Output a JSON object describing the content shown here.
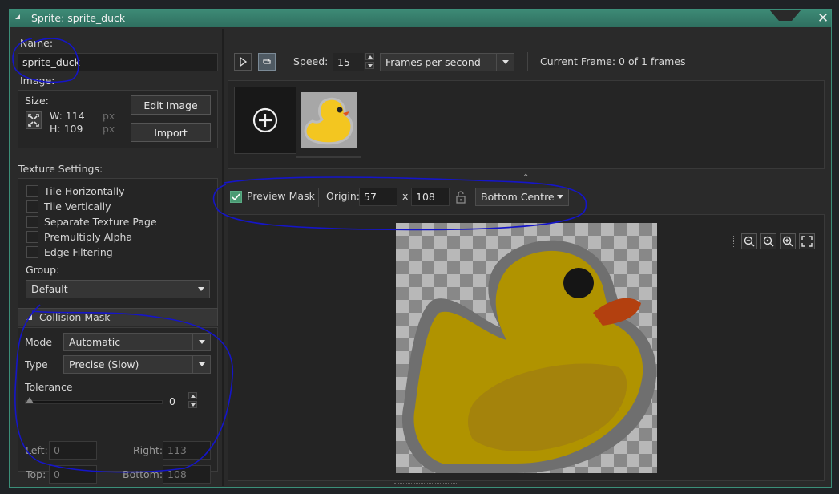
{
  "window": {
    "title": "Sprite: sprite_duck",
    "close_glyph": "✕"
  },
  "name": {
    "label": "Name:",
    "value": "sprite_duck"
  },
  "image": {
    "label": "Image:",
    "size_label": "Size:",
    "width": "W: 114",
    "height": "H: 109",
    "unit": "px",
    "edit_button": "Edit Image",
    "import_button": "Import"
  },
  "texture": {
    "label": "Texture Settings:",
    "options": [
      {
        "label": "Tile Horizontally",
        "checked": false
      },
      {
        "label": "Tile Vertically",
        "checked": false
      },
      {
        "label": "Separate Texture Page",
        "checked": false
      },
      {
        "label": "Premultiply Alpha",
        "checked": false
      },
      {
        "label": "Edge Filtering",
        "checked": false
      }
    ],
    "group_label": "Group:",
    "group_value": "Default"
  },
  "collision": {
    "header": "Collision Mask",
    "mode_label": "Mode",
    "mode_value": "Automatic",
    "type_label": "Type",
    "type_value": "Precise (Slow)",
    "tolerance_label": "Tolerance",
    "tolerance_value": "0",
    "left_label": "Left:",
    "left_value": "0",
    "right_label": "Right:",
    "right_value": "113",
    "top_label": "Top:",
    "top_value": "0",
    "bottom_label": "Bottom:",
    "bottom_value": "108"
  },
  "playback": {
    "speed_label": "Speed:",
    "speed_value": "15",
    "speed_unit": "Frames per second",
    "current_frame": "Current Frame: 0 of 1 frames"
  },
  "mask_bar": {
    "preview_mask_label": "Preview Mask",
    "preview_mask_checked": true,
    "origin_label": "Origin:",
    "origin_x": "57",
    "origin_sep": "x",
    "origin_y": "108",
    "origin_preset": "Bottom Centre"
  },
  "colors": {
    "accent": "#3b8f79",
    "annotation": "#1515c8",
    "duck_yellow": "#b39400",
    "duck_beak": "#b3400f"
  },
  "icons": [
    "play-icon",
    "loop-icon",
    "add-frame-icon",
    "lock-icon",
    "zoom-out-icon",
    "zoom-reset-icon",
    "zoom-in-icon",
    "fit-icon",
    "resize-icon"
  ]
}
